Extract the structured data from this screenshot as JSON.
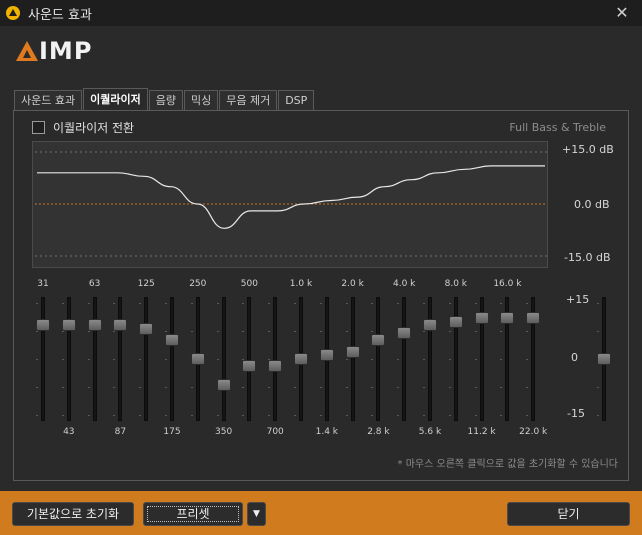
{
  "window": {
    "title": "사운드 효과"
  },
  "logo": {
    "text": "IMP"
  },
  "tabs": [
    {
      "label": "사운드 효과",
      "active": false
    },
    {
      "label": "이퀄라이저",
      "active": true
    },
    {
      "label": "음량",
      "active": false
    },
    {
      "label": "믹싱",
      "active": false
    },
    {
      "label": "무음 제거",
      "active": false
    },
    {
      "label": "DSP",
      "active": false
    }
  ],
  "equalizer": {
    "toggle_label": "이퀄라이저 전환",
    "toggle_checked": false,
    "preset_name": "Full Bass & Treble",
    "curve_labels": {
      "top": "+15.0 dB",
      "mid": "0.0 dB",
      "bottom": "-15.0 dB"
    },
    "scale_labels": {
      "top": "+15",
      "mid": "0",
      "bottom": "-15"
    },
    "bands": [
      {
        "freq": "31",
        "gain": 9
      },
      {
        "freq": "43",
        "gain": 9
      },
      {
        "freq": "63",
        "gain": 9
      },
      {
        "freq": "87",
        "gain": 9
      },
      {
        "freq": "125",
        "gain": 8
      },
      {
        "freq": "175",
        "gain": 5
      },
      {
        "freq": "250",
        "gain": 0
      },
      {
        "freq": "350",
        "gain": -7
      },
      {
        "freq": "500",
        "gain": -2
      },
      {
        "freq": "700",
        "gain": -2
      },
      {
        "freq": "1.0 k",
        "gain": 0
      },
      {
        "freq": "1.4 k",
        "gain": 1
      },
      {
        "freq": "2.0 k",
        "gain": 2
      },
      {
        "freq": "2.8 k",
        "gain": 5
      },
      {
        "freq": "4.0 k",
        "gain": 7
      },
      {
        "freq": "5.6 k",
        "gain": 9
      },
      {
        "freq": "8.0 k",
        "gain": 10
      },
      {
        "freq": "11.2 k",
        "gain": 11
      },
      {
        "freq": "16.0 k",
        "gain": 11
      },
      {
        "freq": "22.0 k",
        "gain": 11
      }
    ],
    "preamp_gain": 0,
    "hint": "* 마우스 오른쪽 클릭으로 값을 초기화할 수 있습니다"
  },
  "footer": {
    "reset_label": "기본값으로 초기화",
    "preset_label": "프리셋",
    "close_label": "닫기"
  },
  "colors": {
    "accent": "#cf7b1e",
    "curve": "#e8e8e8",
    "zero_line": "#c8782a",
    "grid": "#707070"
  }
}
